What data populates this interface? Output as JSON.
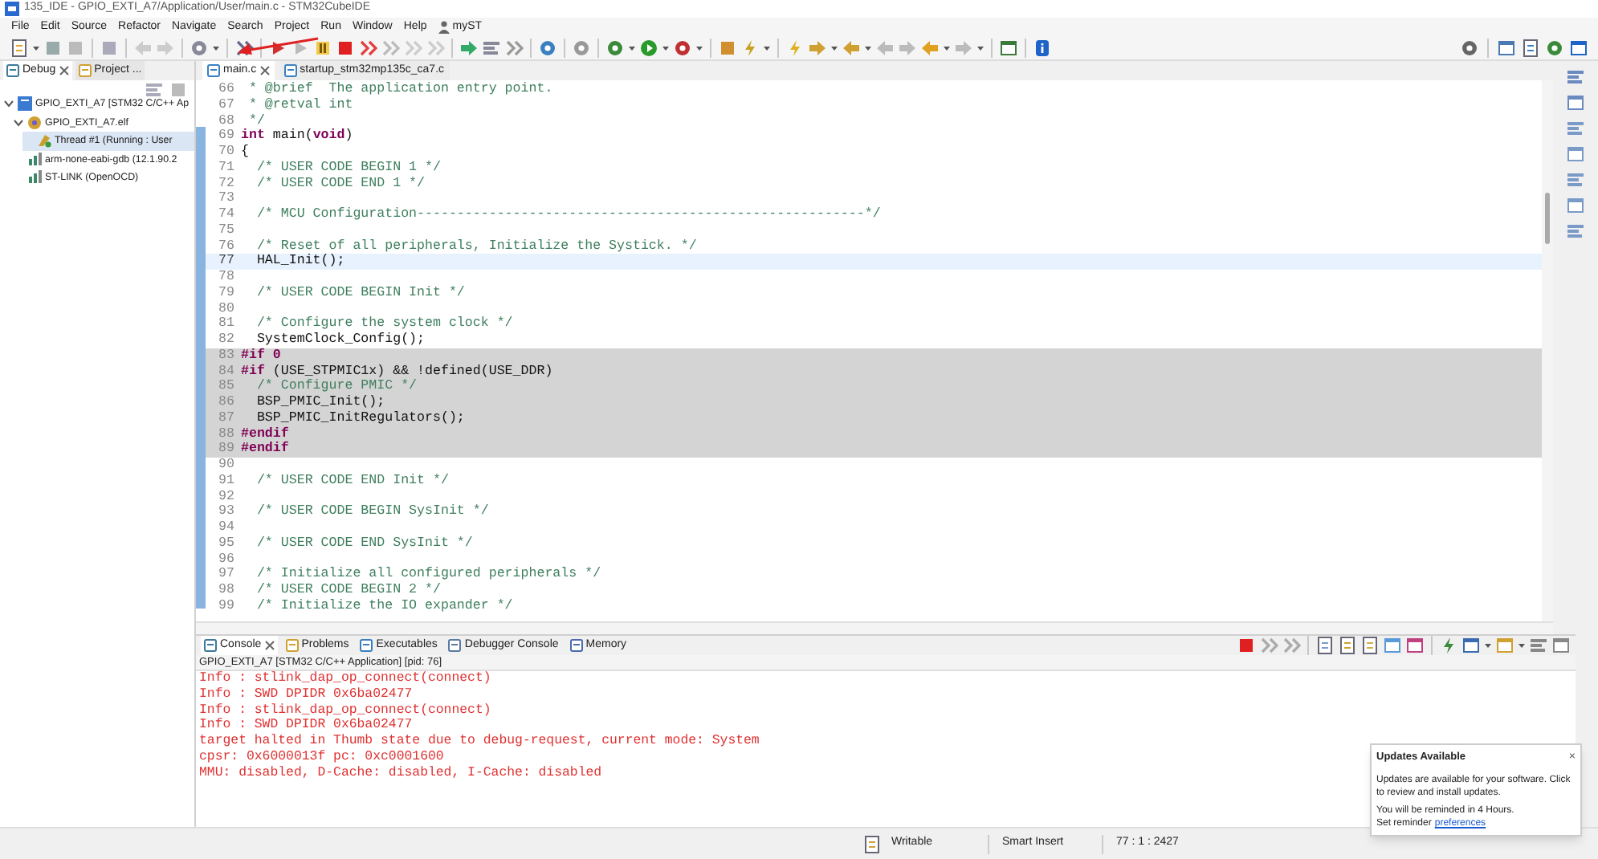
{
  "window": {
    "title": "135_IDE - GPIO_EXTI_A7/Application/User/main.c - STM32CubeIDE"
  },
  "menu": [
    "File",
    "Edit",
    "Source",
    "Refactor",
    "Navigate",
    "Search",
    "Project",
    "Run",
    "Window",
    "Help",
    "myST"
  ],
  "left_panel": {
    "tabs": [
      {
        "label": "Debug",
        "selected": true
      },
      {
        "label": "Project ...",
        "selected": false
      }
    ],
    "tree": [
      {
        "label": "GPIO_EXTI_A7 [STM32 C/C++ Ap",
        "kind": "project",
        "expanded": true,
        "children": [
          {
            "label": "GPIO_EXTI_A7.elf",
            "kind": "binary",
            "expanded": true,
            "children": [
              {
                "label": "Thread #1 (Running : User",
                "kind": "thread"
              }
            ]
          },
          {
            "label": "arm-none-eabi-gdb (12.1.90.2",
            "kind": "process"
          },
          {
            "label": "ST-LINK (OpenOCD)",
            "kind": "process"
          }
        ]
      }
    ]
  },
  "editor": {
    "tabs": [
      {
        "label": "main.c",
        "selected": true
      },
      {
        "label": "startup_stm32mp135c_ca7.c",
        "selected": false
      }
    ],
    "lines": [
      {
        "num": "66",
        "text": " * @brief  The application entry point.",
        "kind": "comment",
        "current": false,
        "shaded": false
      },
      {
        "num": "67",
        "text": " * @retval int",
        "kind": "comment",
        "current": false,
        "shaded": false
      },
      {
        "num": "68",
        "text": " */",
        "kind": "comment",
        "current": false,
        "shaded": false
      },
      {
        "num": "69",
        "text": "**int** main(**void**)",
        "kind": "code",
        "current": false,
        "shaded": false
      },
      {
        "num": "70",
        "text": "{",
        "kind": "code",
        "current": false,
        "shaded": false
      },
      {
        "num": "71",
        "text": "  /* USER CODE BEGIN 1 */",
        "kind": "comment",
        "current": false,
        "shaded": false
      },
      {
        "num": "72",
        "text": "  /* USER CODE END 1 */",
        "kind": "comment",
        "current": false,
        "shaded": false
      },
      {
        "num": "73",
        "kind": "code",
        "current": false,
        "shaded": false
      },
      {
        "num": "74",
        "text": "  /* MCU Configuration--------------------------------------------------------*/",
        "kind": "comment",
        "current": false,
        "shaded": false
      },
      {
        "num": "75",
        "kind": "code",
        "current": false,
        "shaded": false
      },
      {
        "num": "76",
        "text": "  /* Reset of all peripherals, Initialize the Systick. */",
        "kind": "comment",
        "current": false,
        "shaded": false
      },
      {
        "num": "77",
        "text": "  HAL_Init();",
        "kind": "code",
        "current": true,
        "shaded": false
      },
      {
        "num": "78",
        "kind": "code",
        "current": false,
        "shaded": false
      },
      {
        "num": "79",
        "text": "  /* USER CODE BEGIN Init */",
        "kind": "comment",
        "current": false,
        "shaded": false
      },
      {
        "num": "80",
        "kind": "code",
        "current": false,
        "shaded": false
      },
      {
        "num": "81",
        "text": "  /* Configure the system clock */",
        "kind": "comment",
        "current": false,
        "shaded": false
      },
      {
        "num": "82",
        "text": "  SystemClock_Config();",
        "kind": "code",
        "current": false,
        "shaded": false
      },
      {
        "num": "83",
        "text": "#if 0",
        "kind": "preproc",
        "current": false,
        "shaded": true
      },
      {
        "num": "84",
        "text": "**#if** (USE_STPMIC1x) && !defined(USE_DDR)",
        "kind": "code",
        "current": false,
        "shaded": true
      },
      {
        "num": "85",
        "text": "  /* Configure PMIC */",
        "kind": "comment",
        "current": false,
        "shaded": true
      },
      {
        "num": "86",
        "text": "  BSP_PMIC_Init();",
        "kind": "code",
        "current": false,
        "shaded": true
      },
      {
        "num": "87",
        "text": "  BSP_PMIC_InitRegulators();",
        "kind": "code",
        "current": false,
        "shaded": true
      },
      {
        "num": "88",
        "text": "#endif",
        "kind": "preproc",
        "current": false,
        "shaded": true
      },
      {
        "num": "89",
        "text": "#endif",
        "kind": "preproc",
        "current": false,
        "shaded": true
      },
      {
        "num": "90",
        "kind": "code",
        "current": false,
        "shaded": false
      },
      {
        "num": "91",
        "text": "  /* USER CODE END Init */",
        "kind": "comment",
        "current": false,
        "shaded": false
      },
      {
        "num": "92",
        "kind": "code",
        "current": false,
        "shaded": false
      },
      {
        "num": "93",
        "text": "  /* USER CODE BEGIN SysInit */",
        "kind": "comment",
        "current": false,
        "shaded": false
      },
      {
        "num": "94",
        "kind": "code",
        "current": false,
        "shaded": false
      },
      {
        "num": "95",
        "text": "  /* USER CODE END SysInit */",
        "kind": "comment",
        "current": false,
        "shaded": false
      },
      {
        "num": "96",
        "kind": "code",
        "current": false,
        "shaded": false
      },
      {
        "num": "97",
        "text": "  /* Initialize all configured peripherals */",
        "kind": "comment",
        "current": false,
        "shaded": false
      },
      {
        "num": "98",
        "text": "  /* USER CODE BEGIN 2 */",
        "kind": "comment",
        "current": false,
        "shaded": false
      },
      {
        "num": "99",
        "text": "  /* Initialize the IO expander */",
        "kind": "comment",
        "current": false,
        "shaded": false
      }
    ]
  },
  "console": {
    "tabs": [
      {
        "label": "Console",
        "selected": true
      },
      {
        "label": "Problems",
        "selected": false
      },
      {
        "label": "Executables",
        "selected": false
      },
      {
        "label": "Debugger Console",
        "selected": false
      },
      {
        "label": "Memory",
        "selected": false
      }
    ],
    "header": "GPIO_EXTI_A7 [STM32 C/C++ Application]  [pid: 76]",
    "output": [
      "Info : stlink_dap_op_connect(connect)",
      "Info : SWD DPIDR 0x6ba02477",
      "Info : stlink_dap_op_connect(connect)",
      "Info : SWD DPIDR 0x6ba02477",
      "target halted in Thumb state due to debug-request, current mode: System",
      "cpsr: 0x6000013f pc: 0xc0001600",
      "MMU: disabled, D-Cache: disabled, I-Cache: disabled"
    ]
  },
  "status_bar": {
    "mode": "Writable",
    "insert": "Smart Insert",
    "position": "77 : 1 : 2427"
  },
  "notification": {
    "title": "Updates Available",
    "close": "×",
    "body": "Updates are available for your software. Click to review and install updates.",
    "reminder": "You will be reminded in 4 Hours.",
    "set_reminder": "Set reminder",
    "link": "preferences"
  }
}
